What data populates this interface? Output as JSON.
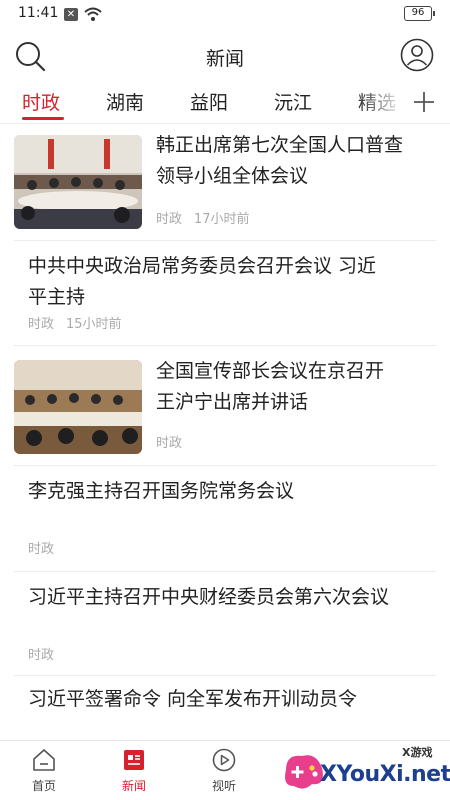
{
  "status_bar": {
    "time": "11:41",
    "battery": "96"
  },
  "header": {
    "title": "新闻"
  },
  "tabs": [
    {
      "label": "时政"
    },
    {
      "label": "湖南"
    },
    {
      "label": "益阳"
    },
    {
      "label": "沅江"
    },
    {
      "label": "精选"
    }
  ],
  "feed": [
    {
      "title_line1": "韩正出席第七次全国人口普查",
      "title_line2": "领导小组全体会议",
      "category": "时政",
      "time": "17小时前"
    },
    {
      "title_line1": "中共中央政治局常务委员会召开会议 习近",
      "title_line2": "平主持",
      "category": "时政",
      "time": "15小时前"
    },
    {
      "title_line1": "全国宣传部长会议在京召开",
      "title_line2": "王沪宁出席并讲话",
      "category": "时政",
      "time": ""
    },
    {
      "title_line1": "李克强主持召开国务院常务会议",
      "title_line2": "",
      "category": "时政",
      "time": ""
    },
    {
      "title_line1": "习近平主持召开中央财经委员会第六次会议",
      "title_line2": "",
      "category": "时政",
      "time": ""
    },
    {
      "title_line1": "习近平签署命令 向全军发布开训动员令",
      "title_line2": "",
      "category": "",
      "time": ""
    }
  ],
  "bottom_nav": [
    {
      "label": "首页"
    },
    {
      "label": "新闻"
    },
    {
      "label": "视听"
    }
  ],
  "watermark": {
    "brand": "XYouXi.net",
    "tag": "X游戏"
  },
  "colors": {
    "accent": "#d6212f",
    "muted": "#aaaaaa",
    "separator": "#ececec"
  }
}
